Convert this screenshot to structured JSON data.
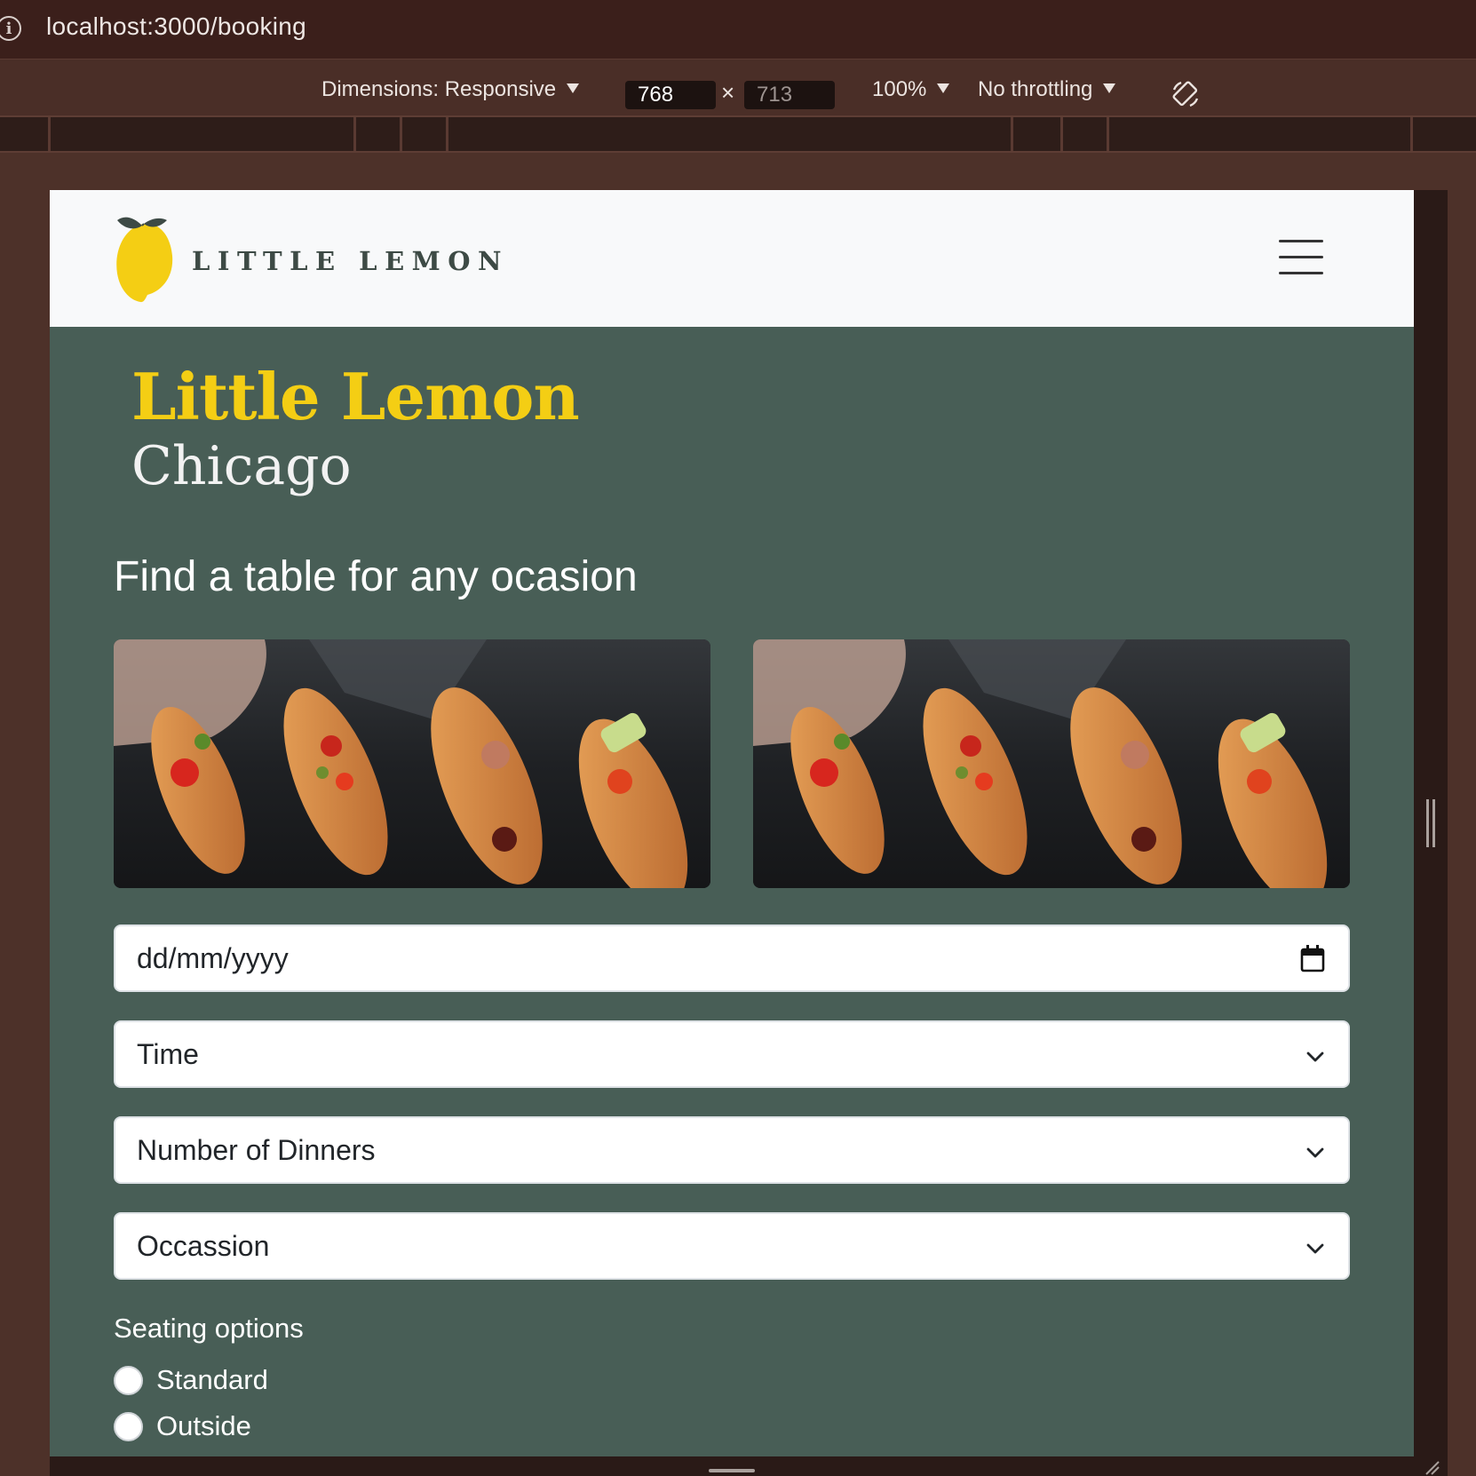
{
  "browser": {
    "url": "localhost:3000/booking"
  },
  "devtools": {
    "dimensions_label": "Dimensions: Responsive",
    "width": "768",
    "height": "713",
    "zoom": "100%",
    "throttling": "No throttling"
  },
  "header": {
    "logo_text": "LITTLE LEMON"
  },
  "hero": {
    "title": "Little Lemon",
    "subtitle": "Chicago"
  },
  "booking": {
    "heading": "Find a table for any ocasion",
    "date_placeholder": "dd/mm/yyyy",
    "time_label": "Time",
    "diners_label": "Number of Dinners",
    "occasion_label": "Occassion",
    "seating_label": "Seating options",
    "seating_options": [
      "Standard",
      "Outside"
    ]
  },
  "colors": {
    "brand_yellow": "#f4ce14",
    "brand_green": "#485e56",
    "header_bg": "#f8f9fa"
  }
}
